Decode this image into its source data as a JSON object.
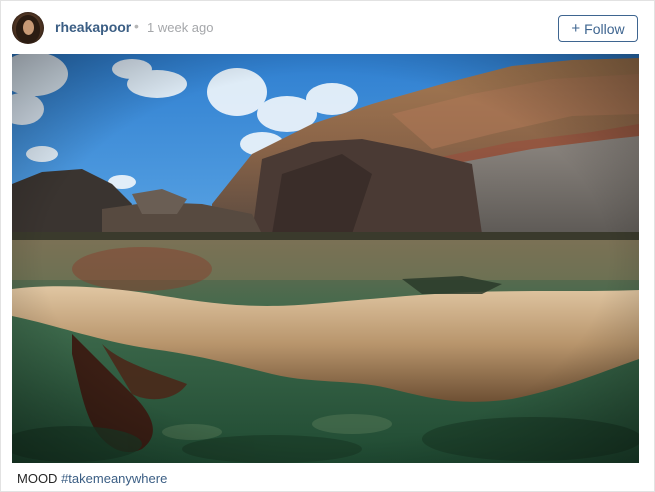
{
  "post": {
    "username": "rheakapoor",
    "separator": "•",
    "timestamp": "1 week ago",
    "follow_button": {
      "icon": "plus-icon",
      "label": "Follow"
    },
    "avatar_icon": "profile-avatar",
    "photo": {
      "description_icon": "beach-photo",
      "scene": "split-level underwater photo"
    },
    "caption": {
      "text": "MOOD",
      "hashtag": "#takemeanywhere"
    }
  },
  "colors": {
    "username": "#3b5e84",
    "follow_border": "#3e6590",
    "timestamp": "#a5a7aa",
    "sky": "#3f8fd6",
    "water": "#2f6b4a"
  }
}
